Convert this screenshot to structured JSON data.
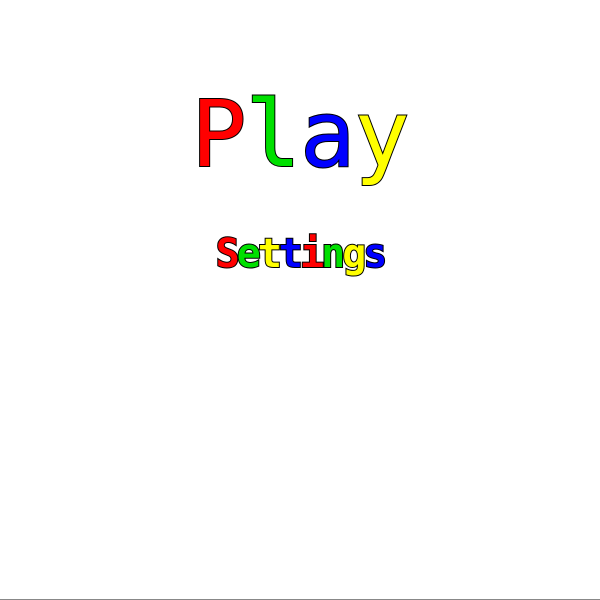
{
  "menu": {
    "play": {
      "label": "Play",
      "letters": [
        {
          "char": "P",
          "color": "#ff0000"
        },
        {
          "char": "l",
          "color": "#00e000"
        },
        {
          "char": "a",
          "color": "#0000ff"
        },
        {
          "char": "y",
          "color": "#ffff00"
        }
      ]
    },
    "settings": {
      "label": "Settings",
      "letters": [
        {
          "char": "S",
          "color": "#ff0000"
        },
        {
          "char": "e",
          "color": "#00e000"
        },
        {
          "char": "t",
          "color": "#ffff00"
        },
        {
          "char": "t",
          "color": "#0000ff"
        },
        {
          "char": "i",
          "color": "#ff0000"
        },
        {
          "char": "n",
          "color": "#00e000"
        },
        {
          "char": "g",
          "color": "#ffff00"
        },
        {
          "char": "s",
          "color": "#0000ff"
        }
      ]
    }
  }
}
